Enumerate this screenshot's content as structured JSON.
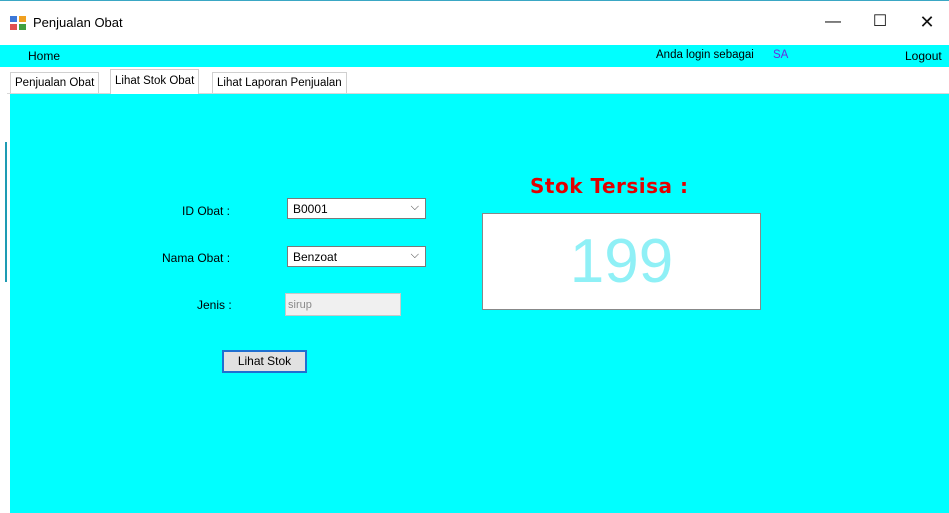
{
  "window": {
    "title": "Penjualan Obat",
    "minimize_glyph": "—",
    "maximize_glyph": "☐",
    "close_glyph": "✕"
  },
  "menu": {
    "home": "Home",
    "login_label": "Anda login sebagai",
    "login_user": "SA",
    "logout": "Logout"
  },
  "tabs": [
    {
      "label": "Penjualan Obat",
      "active": false
    },
    {
      "label": "Lihat Stok Obat",
      "active": true
    },
    {
      "label": "Lihat Laporan Penjualan",
      "active": false
    }
  ],
  "form": {
    "id_label": "ID Obat :",
    "id_value": "B0001",
    "nama_label": "Nama Obat :",
    "nama_value": "Benzoat",
    "jenis_label": "Jenis :",
    "jenis_value": "sirup",
    "lihat_button": "Lihat Stok"
  },
  "stok": {
    "title": "Stok Tersisa :",
    "value": "199"
  },
  "icons": {
    "dropdown": "⌵"
  },
  "colors": {
    "background": "#00ffff",
    "title_red": "#e20000",
    "stock_value": "#8ff0f6",
    "user_purple": "#6a2ce0"
  }
}
